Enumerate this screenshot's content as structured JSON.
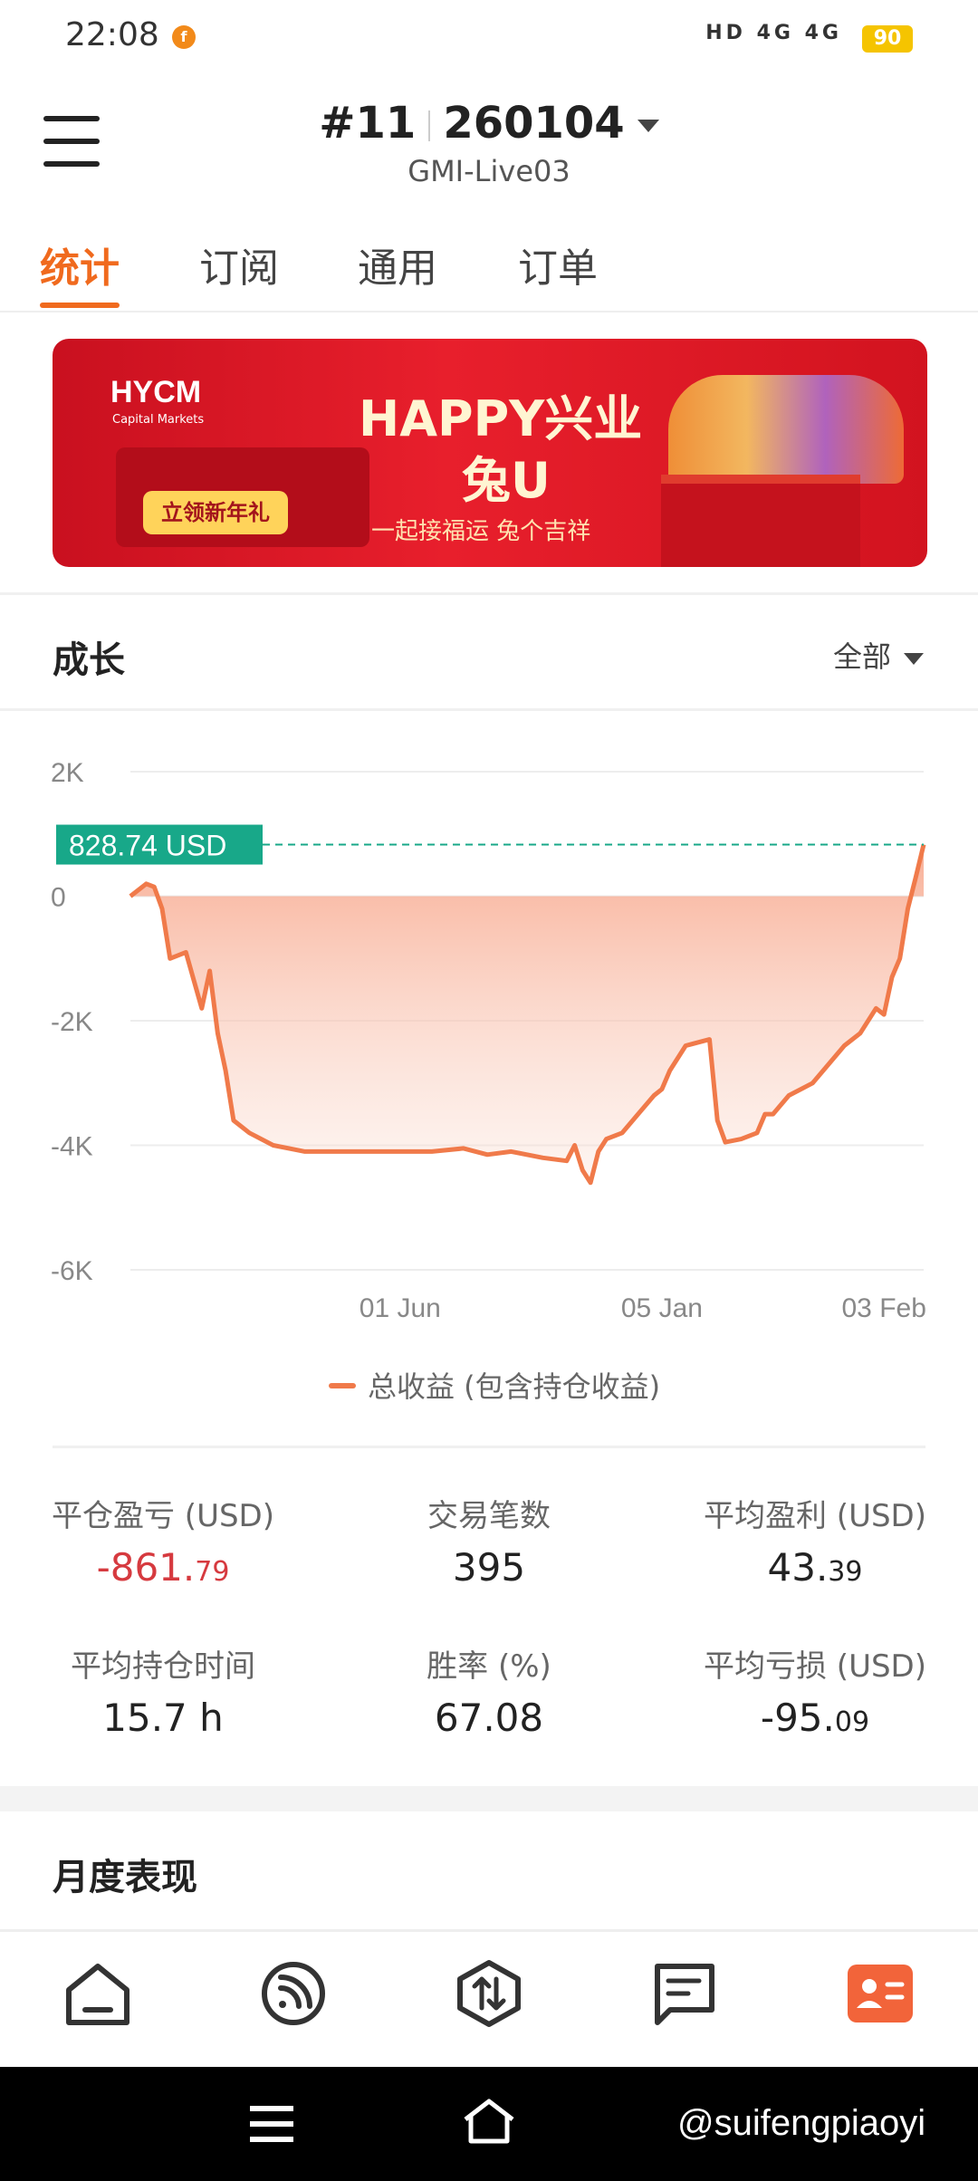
{
  "status_bar": {
    "time": "22:08",
    "network": "HD 4G 4G",
    "battery": "90"
  },
  "header": {
    "account_number": "#11",
    "account_suffix": "260104",
    "server": "GMI-Live03"
  },
  "tabs": [
    {
      "label": "统计",
      "active": true
    },
    {
      "label": "订阅",
      "active": false
    },
    {
      "label": "通用",
      "active": false
    },
    {
      "label": "订单",
      "active": false
    }
  ],
  "banner": {
    "logo": "HYCM",
    "logo_sub": "Capital Markets",
    "cta": "立领新年礼",
    "headline1": "HAPPY兴业",
    "headline2": "兔U",
    "tagline": "一起接福运 兔个吉祥"
  },
  "growth": {
    "title": "成长",
    "filter": "全部"
  },
  "chart_data": {
    "type": "area",
    "ylim": [
      -6000,
      2000
    ],
    "yticks": [
      {
        "value": 2000,
        "label": "2K"
      },
      {
        "value": 0,
        "label": "0"
      },
      {
        "value": -2000,
        "label": "-2K"
      },
      {
        "value": -4000,
        "label": "-4K"
      },
      {
        "value": -6000,
        "label": "-6K"
      }
    ],
    "xticks": [
      {
        "pos": 0.34,
        "label": "01 Jun"
      },
      {
        "pos": 0.67,
        "label": "05 Jan"
      },
      {
        "pos": 0.95,
        "label": "03 Feb"
      }
    ],
    "current_label": "828.74 USD",
    "current_value": 828.74,
    "legend": "总收益 (包含持仓收益)",
    "line_color": "#f07a4a",
    "label_color": "#18a889",
    "series": [
      {
        "name": "总收益 (包含持仓收益)",
        "points": [
          [
            0.0,
            0
          ],
          [
            0.02,
            200
          ],
          [
            0.03,
            150
          ],
          [
            0.04,
            -200
          ],
          [
            0.05,
            -1000
          ],
          [
            0.07,
            -900
          ],
          [
            0.09,
            -1800
          ],
          [
            0.1,
            -1200
          ],
          [
            0.11,
            -2200
          ],
          [
            0.12,
            -2800
          ],
          [
            0.13,
            -3600
          ],
          [
            0.15,
            -3800
          ],
          [
            0.18,
            -4000
          ],
          [
            0.22,
            -4100
          ],
          [
            0.26,
            -4100
          ],
          [
            0.3,
            -4100
          ],
          [
            0.34,
            -4100
          ],
          [
            0.38,
            -4100
          ],
          [
            0.42,
            -4050
          ],
          [
            0.45,
            -4150
          ],
          [
            0.48,
            -4100
          ],
          [
            0.52,
            -4200
          ],
          [
            0.55,
            -4250
          ],
          [
            0.56,
            -4000
          ],
          [
            0.57,
            -4400
          ],
          [
            0.58,
            -4600
          ],
          [
            0.59,
            -4100
          ],
          [
            0.6,
            -3900
          ],
          [
            0.62,
            -3800
          ],
          [
            0.64,
            -3500
          ],
          [
            0.66,
            -3200
          ],
          [
            0.67,
            -3100
          ],
          [
            0.68,
            -2800
          ],
          [
            0.7,
            -2400
          ],
          [
            0.73,
            -2300
          ],
          [
            0.74,
            -3600
          ],
          [
            0.75,
            -3950
          ],
          [
            0.77,
            -3900
          ],
          [
            0.79,
            -3800
          ],
          [
            0.8,
            -3500
          ],
          [
            0.81,
            -3500
          ],
          [
            0.83,
            -3200
          ],
          [
            0.86,
            -3000
          ],
          [
            0.88,
            -2700
          ],
          [
            0.9,
            -2400
          ],
          [
            0.92,
            -2200
          ],
          [
            0.94,
            -1800
          ],
          [
            0.95,
            -1900
          ],
          [
            0.96,
            -1300
          ],
          [
            0.97,
            -1000
          ],
          [
            0.98,
            -200
          ],
          [
            0.99,
            300
          ],
          [
            1.0,
            828.74
          ]
        ]
      }
    ]
  },
  "stats": [
    {
      "label": "平仓盈亏 (USD)",
      "int": "-861.",
      "frac": "79",
      "negative": true
    },
    {
      "label": "交易笔数",
      "int": "395",
      "frac": "",
      "negative": false
    },
    {
      "label": "平均盈利 (USD)",
      "int": "43.",
      "frac": "39",
      "negative": false
    },
    {
      "label": "平均持仓时间",
      "int": "15.7 h",
      "frac": "",
      "negative": false
    },
    {
      "label": "胜率 (%)",
      "int": "67.08",
      "frac": "",
      "negative": false
    },
    {
      "label": "平均亏损 (USD)",
      "int": "-95.",
      "frac": "09",
      "negative": false
    }
  ],
  "monthly": {
    "title": "月度表现"
  },
  "bottom_nav": [
    {
      "name": "home-icon"
    },
    {
      "name": "feed-icon"
    },
    {
      "name": "trade-icon"
    },
    {
      "name": "message-icon"
    },
    {
      "name": "profile-icon",
      "active": true
    }
  ],
  "system_nav": {
    "watermark": "@suifengpiaoyi"
  }
}
